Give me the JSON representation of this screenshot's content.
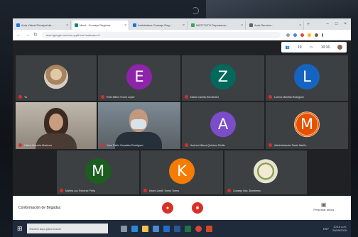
{
  "browser": {
    "tabs": [
      {
        "label": "Aula Virtual Principal de...",
        "color": "#1a73e8"
      },
      {
        "label": "Meet - Consejo Regiona...",
        "color": "#00897b",
        "active": true
      },
      {
        "label": "Actividades Consejo Reg...",
        "color": "#1a73e8"
      },
      {
        "label": "INSTITUTO Departame...",
        "color": "#34a853"
      },
      {
        "label": "Acta Reunion...",
        "color": "#5f6368"
      }
    ],
    "url": "meet.google.com/rzu-yqbf-trm?authuser=0",
    "new_tab": "+",
    "min": "–",
    "max": "□",
    "close": "×"
  },
  "meet_top": {
    "people_count": "19",
    "time": "10:16"
  },
  "participants": [
    {
      "name": "Yo",
      "type": "photo",
      "letter": "",
      "color": "#c9b08a"
    },
    {
      "name": "Ruth Mileni Torres López",
      "type": "letter",
      "letter": "E",
      "color": "#8e24aa"
    },
    {
      "name": "Diana Camila Hernández",
      "type": "letter",
      "letter": "Z",
      "color": "#00695c"
    },
    {
      "name": "Lorena Mantilla Rodriguez",
      "type": "letter",
      "letter": "L",
      "color": "#1565c0"
    },
    {
      "name": "Liliana Marcela Martínez",
      "type": "video",
      "letter": "",
      "color": "#6b6760"
    },
    {
      "name": "Juan Pablo González Rodríguez",
      "type": "video",
      "letter": "",
      "color": "#5b5e64"
    },
    {
      "name": "Andrea Milena Quintero Pinilla",
      "type": "letter",
      "letter": "A",
      "color": "#7b4dc9"
    },
    {
      "name": "Administración Pasto Nariño",
      "type": "letter",
      "letter": "M",
      "color": "#e65100"
    },
    {
      "name": "Martha Luz Ramírez Peña",
      "type": "letter",
      "letter": "M",
      "color": "#1b5e20"
    },
    {
      "name": "Karen Lizeth Torres Torres",
      "type": "letter",
      "letter": "K",
      "color": "#f57c00"
    },
    {
      "name": "Consejo Nac. Bomberos",
      "type": "logo",
      "letter": "",
      "color": "#e9e4cf"
    }
  ],
  "callbar": {
    "title": "Conformación de Brigadas",
    "present_label": "Presentar ahora",
    "mic_icon": "mic-off-icon",
    "cam_icon": "cam-off-icon"
  },
  "taskbar": {
    "search_placeholder": "Escribe aquí para buscar",
    "time": "10:16 a.m.",
    "date": "29/09/2020",
    "lang": "ESP"
  }
}
